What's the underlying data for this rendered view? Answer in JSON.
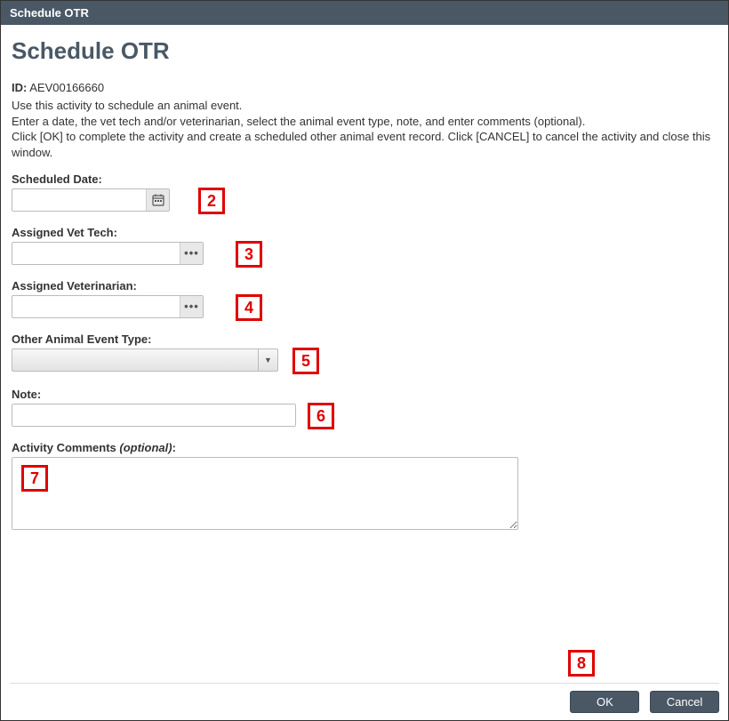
{
  "titlebar": {
    "title": "Schedule OTR"
  },
  "page": {
    "heading": "Schedule OTR",
    "id_label": "ID:",
    "id_value": "AEV00166660",
    "instructions_line1": "Use this activity to schedule an animal event.",
    "instructions_line2": "Enter a date, the vet tech and/or veterinarian, select the animal event type, note, and enter comments (optional).",
    "instructions_line3": "Click [OK] to complete the activity and create a scheduled other animal event record. Click [CANCEL] to cancel the activity and close this window."
  },
  "fields": {
    "scheduled_date": {
      "label": "Scheduled Date:",
      "value": ""
    },
    "assigned_vet_tech": {
      "label": "Assigned Vet Tech:",
      "value": ""
    },
    "assigned_veterinarian": {
      "label": "Assigned Veterinarian:",
      "value": ""
    },
    "other_event_type": {
      "label": "Other Animal Event Type:",
      "value": ""
    },
    "note": {
      "label": "Note:",
      "value": ""
    },
    "activity_comments": {
      "label_main": "Activity Comments",
      "label_optional": "(optional)",
      "label_colon": ":",
      "value": ""
    }
  },
  "buttons": {
    "ok": "OK",
    "cancel": "Cancel"
  },
  "callouts": {
    "c2": "2",
    "c3": "3",
    "c4": "4",
    "c5": "5",
    "c6": "6",
    "c7": "7",
    "c8": "8"
  }
}
